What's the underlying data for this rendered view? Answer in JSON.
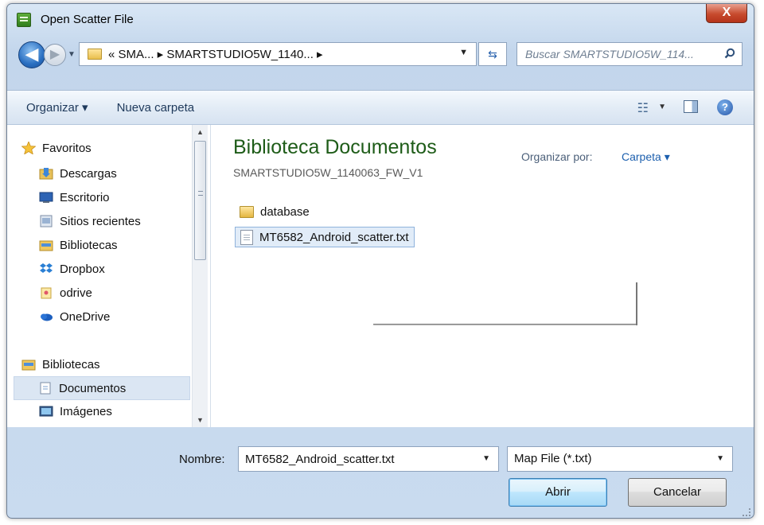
{
  "window": {
    "title": "Open Scatter File",
    "close_label": "X"
  },
  "navbar": {
    "back_glyph": "◀",
    "forward_glyph": "▶",
    "breadcrumb": "« SMA... ▸ SMARTSTUDIO5W_1140... ▸",
    "search_placeholder": "Buscar SMARTSTUDIO5W_114...",
    "icons": [
      "back-icon",
      "forward-icon",
      "refresh-icon",
      "search-icon",
      "folder-icon"
    ]
  },
  "toolbar": {
    "organize_label": "Organizar ▾",
    "new_folder_label": "Nueva carpeta",
    "help_label": "?"
  },
  "sidebar": {
    "items": [
      {
        "label": "Favoritos",
        "icon": "star-icon"
      },
      {
        "label": "Descargas",
        "icon": "downloads-icon"
      },
      {
        "label": "Escritorio",
        "icon": "desktop-icon"
      },
      {
        "label": "Sitios recientes",
        "icon": "recent-places-icon"
      },
      {
        "label": "Bibliotecas",
        "icon": "libraries-icon"
      },
      {
        "label": "Dropbox",
        "icon": "dropbox-icon"
      },
      {
        "label": "odrive",
        "icon": "odrive-icon"
      },
      {
        "label": "OneDrive",
        "icon": "onedrive-icon"
      },
      {
        "label": "Bibliotecas",
        "icon": "libraries-icon"
      },
      {
        "label": "Documentos",
        "icon": "documents-icon",
        "selected": true
      },
      {
        "label": "Imágenes",
        "icon": "pictures-icon"
      }
    ]
  },
  "main": {
    "library_title": "Biblioteca Documentos",
    "library_path": "SMARTSTUDIO5W_1140063_FW_V1",
    "arrange_label": "Organizar por:",
    "arrange_value": "Carpeta ▾",
    "files": [
      {
        "name": "database",
        "type": "folder"
      },
      {
        "name": "MT6582_Android_scatter.txt",
        "type": "file",
        "selected": true
      }
    ]
  },
  "footer": {
    "filename_label": "Nombre:",
    "filename_value": "MT6582_Android_scatter.txt",
    "filter_value": "Map File (*.txt)",
    "open_label": "Abrir",
    "cancel_label": "Cancelar"
  },
  "colors": {
    "library_title": "#1e5c18",
    "link_blue": "#1c5fae",
    "close_red": "#c74b2e"
  }
}
